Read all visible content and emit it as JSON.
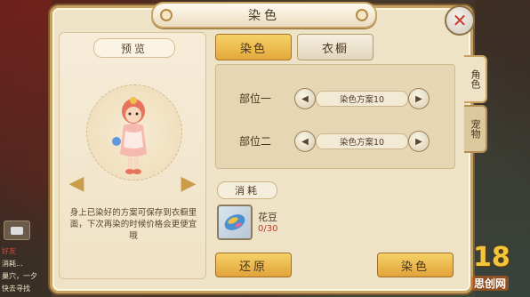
{
  "title": "染色",
  "close_icon": "close-icon",
  "preview": {
    "label": "预览",
    "description": "身上已染好的方案可保存到衣橱里面，下次再染的时候价格会更便宜哦",
    "rotate_left_icon": "rotate-left-icon",
    "rotate_right_icon": "rotate-right-icon"
  },
  "tabs": {
    "dye": "染色",
    "wardrobe": "衣橱"
  },
  "slots": [
    {
      "label": "部位一",
      "value": "染色方案10"
    },
    {
      "label": "部位二",
      "value": "染色方案10"
    }
  ],
  "consume": {
    "label": "消耗",
    "item_name": "花豆",
    "item_count": "0/30"
  },
  "buttons": {
    "restore": "还原",
    "dye": "染色"
  },
  "side_tabs": {
    "character": "角色",
    "pet": "宠物"
  },
  "chat": {
    "lines": [
      "好友",
      "消耗…",
      "巢穴，一夕",
      "快去寻找"
    ]
  },
  "watermark": {
    "logo": "18",
    "site": "思创网"
  },
  "colors": {
    "accent": "#e3a83b",
    "frame": "#c8a160",
    "count_red": "#c0392b"
  }
}
